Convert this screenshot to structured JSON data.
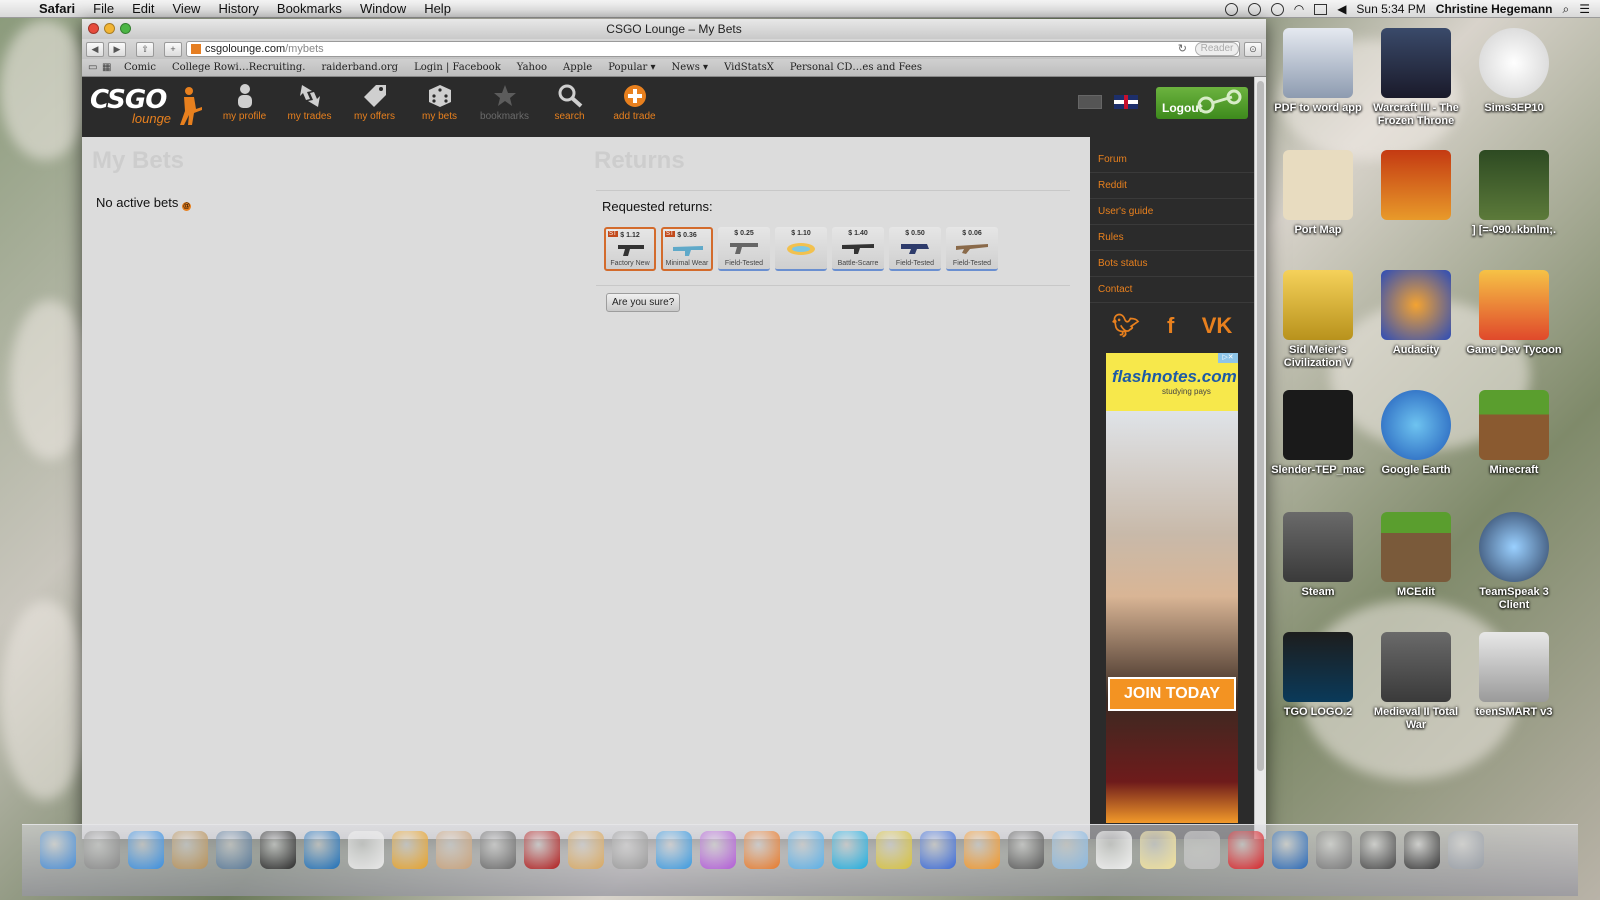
{
  "menubar": {
    "app": "Safari",
    "menus": [
      "File",
      "Edit",
      "View",
      "History",
      "Bookmarks",
      "Window",
      "Help"
    ],
    "clock": "Sun 5:34 PM",
    "user": "Christine Hegemann"
  },
  "window": {
    "title": "CSGO Lounge – My Bets",
    "url_host": "csgolounge.com",
    "url_path": "/mybets",
    "reader_label": "Reader",
    "bookmarks": [
      "Comic",
      "College Rowi…Recruiting.",
      "raiderband.org",
      "Login | Facebook",
      "Yahoo",
      "Apple",
      "Popular ▾",
      "News ▾",
      "VidStatsX",
      "Personal CD…es and Fees"
    ]
  },
  "site": {
    "logo_main": "CSGO",
    "logo_sub": "lounge",
    "nav": [
      {
        "label": "my profile",
        "icon": "person-icon"
      },
      {
        "label": "my trades",
        "icon": "trades-icon"
      },
      {
        "label": "my offers",
        "icon": "tag-icon"
      },
      {
        "label": "my bets",
        "icon": "dice-icon"
      },
      {
        "label": "bookmarks",
        "icon": "star-icon"
      },
      {
        "label": "search",
        "icon": "search-icon"
      },
      {
        "label": "add trade",
        "icon": "plus-icon"
      }
    ],
    "logout_label": "Logout",
    "accent": "#e8801e"
  },
  "mybets": {
    "title": "My Bets",
    "empty_text": "No active bets"
  },
  "returns": {
    "title": "Returns",
    "requested_label": "Requested returns:",
    "items": [
      {
        "price": "$ 1.12",
        "condition": "Factory New",
        "stattrak": "ST"
      },
      {
        "price": "$ 0.36",
        "condition": "Minimal Wear",
        "stattrak": "ST"
      },
      {
        "price": "$ 0.25",
        "condition": "Field-Tested",
        "stattrak": ""
      },
      {
        "price": "$ 1.10",
        "condition": "",
        "stattrak": ""
      },
      {
        "price": "$ 1.40",
        "condition": "Battle-Scarre",
        "stattrak": ""
      },
      {
        "price": "$ 0.50",
        "condition": "Field-Tested",
        "stattrak": ""
      },
      {
        "price": "$ 0.06",
        "condition": "Field-Tested",
        "stattrak": ""
      }
    ],
    "confirm_label": "Are you sure?"
  },
  "sidebar": {
    "links": [
      "Forum",
      "Reddit",
      "User's guide",
      "Rules",
      "Bots status",
      "Contact"
    ],
    "socials": [
      "twitter-icon",
      "facebook-icon",
      "vk-icon"
    ]
  },
  "ad": {
    "brand": "flashnotes.com",
    "tagline": "studying pays",
    "cta": "JOIN TODAY"
  },
  "desktop": {
    "icons": [
      "PDF to word app",
      "Warcraft III - The Frozen Throne",
      "Sims3EP10",
      "Port Map",
      "",
      "]\n[=-090..kbnlm;.",
      "Sid Meier's Civilization V",
      "Audacity",
      "Game Dev Tycoon",
      "Slender-TEP_mac",
      "Google Earth",
      "Minecraft",
      "Steam",
      "MCEdit",
      "TeamSpeak 3 Client",
      "TGO LOGO.2",
      "Medieval II Total War",
      "teenSMART v3"
    ]
  },
  "dock": {
    "count": 33
  }
}
